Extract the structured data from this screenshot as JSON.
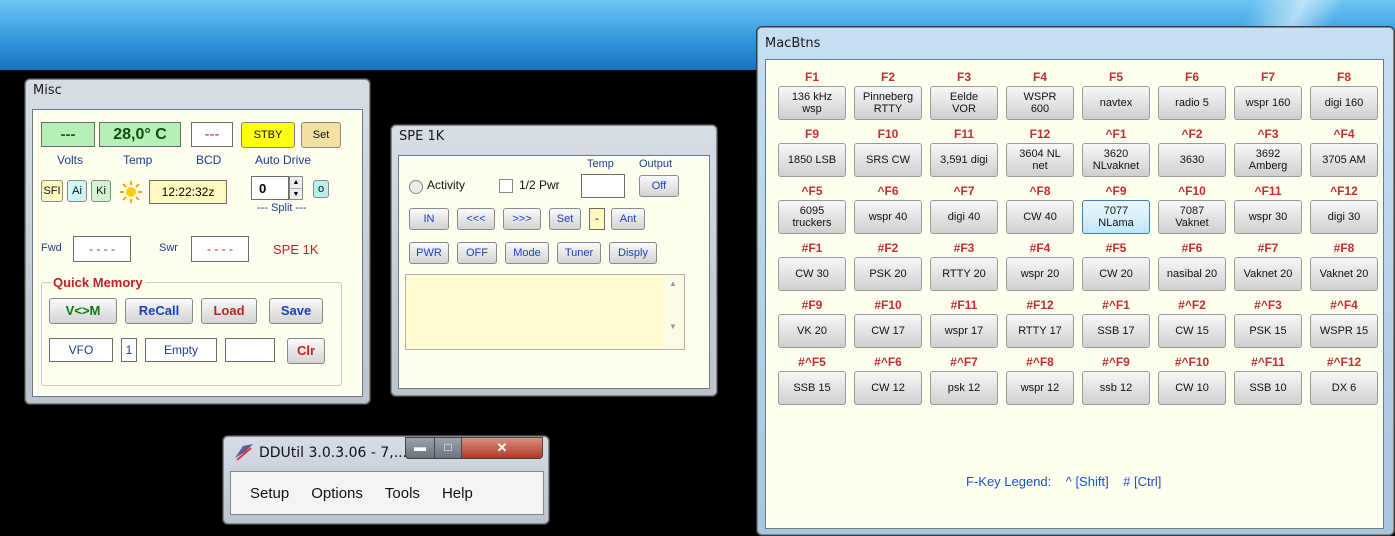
{
  "misc": {
    "title": "Misc",
    "volts_value": "---",
    "temp_value": "28,0° C",
    "bcd_value": "---",
    "stby_label": "STBY",
    "set_label": "Set",
    "volts_label": "Volts",
    "temp_label": "Temp",
    "bcd_label": "BCD",
    "auto_drive_label": "Auto Drive",
    "sfi_label": "SFI",
    "ai_label": "Ai",
    "ki_label": "Ki",
    "clock": "12:22:32z",
    "split_value": "0",
    "split_o_label": "o",
    "split_label": "--- Split ---",
    "fwd_label": "Fwd",
    "fwd_value": "- - - -",
    "swr_label": "Swr",
    "swr_value": "- - - -",
    "spe_label": "SPE 1K",
    "quick_memory_label": "Quick Memory",
    "vm_label": "V<>M",
    "recall_label": "ReCall",
    "load_label": "Load",
    "save_label": "Save",
    "vfo_label": "VFO",
    "mem_number": "1",
    "mem_status": "Empty",
    "clr_label": "Clr"
  },
  "spe": {
    "title": "SPE 1K",
    "temp_label": "Temp",
    "output_label": "Output",
    "activity_label": "Activity",
    "half_pwr_label": "1/2 Pwr",
    "off_output_label": "Off",
    "in_label": "IN",
    "left_label": "<<<",
    "right_label": ">>>",
    "set_label": "Set",
    "dash_label": "-",
    "ant_label": "Ant",
    "pwr_label": "PWR",
    "off_label": "OFF",
    "mode_label": "Mode",
    "tuner_label": "Tuner",
    "disply_label": "Disply"
  },
  "ddutil": {
    "title": "DDUtil 3.0.3.06 - 7,...",
    "menu": [
      "Setup",
      "Options",
      "Tools",
      "Help"
    ]
  },
  "macbtns": {
    "title": "MacBtns",
    "legend": "F-Key Legend:",
    "legend_shift": "^ [Shift]",
    "legend_ctrl": "# [Ctrl]",
    "rows": [
      [
        {
          "key": "F1",
          "label": "136 kHz\nwsp"
        },
        {
          "key": "F2",
          "label": "Pinneberg\nRTTY"
        },
        {
          "key": "F3",
          "label": "Eelde\nVOR"
        },
        {
          "key": "F4",
          "label": "WSPR\n600"
        },
        {
          "key": "F5",
          "label": "navtex"
        },
        {
          "key": "F6",
          "label": "radio 5"
        },
        {
          "key": "F7",
          "label": "wspr 160"
        },
        {
          "key": "F8",
          "label": "digi 160"
        }
      ],
      [
        {
          "key": "F9",
          "label": "1850 LSB"
        },
        {
          "key": "F10",
          "label": "SRS CW"
        },
        {
          "key": "F11",
          "label": "3,591 digi"
        },
        {
          "key": "F12",
          "label": "3604 NL\nnet"
        },
        {
          "key": "^F1",
          "label": "3620\nNLvaknet"
        },
        {
          "key": "^F2",
          "label": "3630"
        },
        {
          "key": "^F3",
          "label": "3692\nAmberg"
        },
        {
          "key": "^F4",
          "label": "3705 AM"
        }
      ],
      [
        {
          "key": "^F5",
          "label": "6095\ntruckers"
        },
        {
          "key": "^F6",
          "label": "wspr 40"
        },
        {
          "key": "^F7",
          "label": "digi 40"
        },
        {
          "key": "^F8",
          "label": "CW 40"
        },
        {
          "key": "^F9",
          "label": "7077\nNLama",
          "selected": true
        },
        {
          "key": "^F10",
          "label": "7087\nVaknet"
        },
        {
          "key": "^F11",
          "label": "wspr 30"
        },
        {
          "key": "^F12",
          "label": "digi 30"
        }
      ],
      [
        {
          "key": "#F1",
          "label": "CW 30"
        },
        {
          "key": "#F2",
          "label": "PSK 20"
        },
        {
          "key": "#F3",
          "label": "RTTY 20"
        },
        {
          "key": "#F4",
          "label": "wspr 20"
        },
        {
          "key": "#F5",
          "label": "CW 20"
        },
        {
          "key": "#F6",
          "label": "nasibal 20"
        },
        {
          "key": "#F7",
          "label": "Vaknet 20"
        },
        {
          "key": "#F8",
          "label": "Vaknet 20"
        }
      ],
      [
        {
          "key": "#F9",
          "label": "VK 20"
        },
        {
          "key": "#F10",
          "label": "CW 17"
        },
        {
          "key": "#F11",
          "label": "wspr 17"
        },
        {
          "key": "#F12",
          "label": "RTTY 17"
        },
        {
          "key": "#^F1",
          "label": "SSB 17"
        },
        {
          "key": "#^F2",
          "label": "CW 15"
        },
        {
          "key": "#^F3",
          "label": "PSK 15"
        },
        {
          "key": "#^F4",
          "label": "WSPR 15"
        }
      ],
      [
        {
          "key": "#^F5",
          "label": "SSB 15"
        },
        {
          "key": "#^F6",
          "label": "CW 12"
        },
        {
          "key": "#^F7",
          "label": "psk 12"
        },
        {
          "key": "#^F8",
          "label": "wspr 12"
        },
        {
          "key": "#^F9",
          "label": "ssb 12"
        },
        {
          "key": "#^F10",
          "label": "CW 10"
        },
        {
          "key": "#^F11",
          "label": "SSB 10"
        },
        {
          "key": "#^F12",
          "label": "DX 6"
        }
      ]
    ]
  }
}
